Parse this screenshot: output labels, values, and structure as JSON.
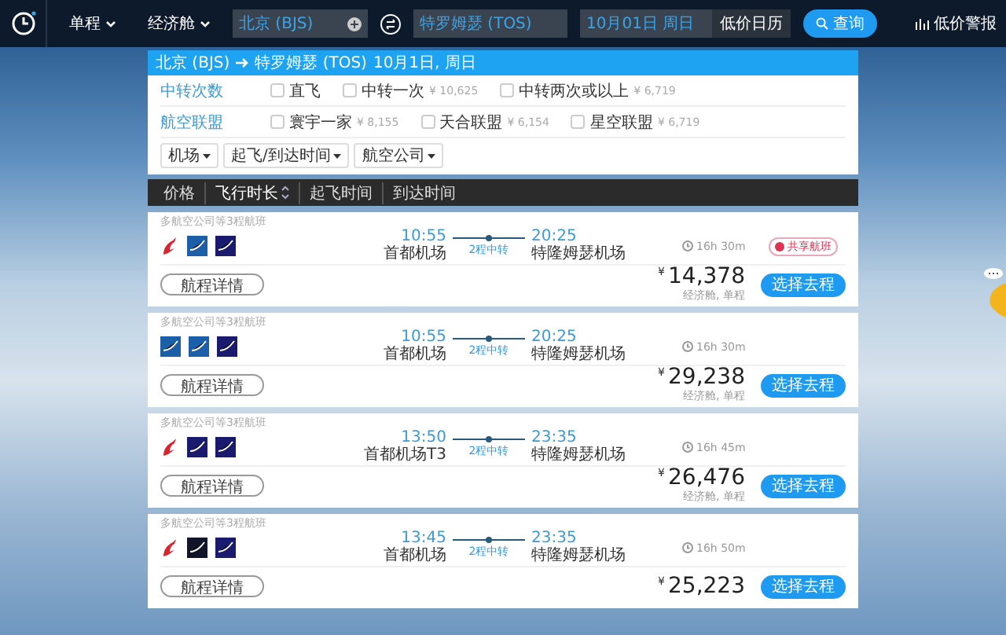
{
  "top_bar": {
    "trip_type": "单程",
    "cabin": "经济舱",
    "origin": "北京 (BJS)",
    "destination": "特罗姆瑟 (TOS)",
    "date": "10月01日 周日",
    "calendar_button": "低价日历",
    "search_button": "查询",
    "alert_link": "低价警报"
  },
  "summary": {
    "origin": "北京 (BJS)",
    "destination": "特罗姆瑟 (TOS)",
    "date": "10月1日, 周日"
  },
  "filters": [
    {
      "label": "中转次数",
      "options": [
        {
          "label": "直飞",
          "checked": false
        },
        {
          "label": "中转一次",
          "price": "¥ 10,625",
          "checked": false
        },
        {
          "label": "中转两次或以上",
          "price": "¥ 6,719",
          "checked": false
        }
      ]
    },
    {
      "label": "航空联盟",
      "options": [
        {
          "label": "寰宇一家",
          "price": "¥ 8,155",
          "checked": false
        },
        {
          "label": "天合联盟",
          "price": "¥ 6,154",
          "checked": false
        },
        {
          "label": "星空联盟",
          "price": "¥ 6,719",
          "checked": false
        }
      ]
    }
  ],
  "dropdowns": [
    "机场",
    "起飞/到达时间",
    "航空公司"
  ],
  "sort_bar": [
    {
      "label": "价格",
      "selected": false
    },
    {
      "label": "飞行时长",
      "selected": true
    },
    {
      "label": "起飞时间",
      "selected": false
    },
    {
      "label": "到达时间",
      "selected": false
    }
  ],
  "flights": [
    {
      "airlines_note": "多航空公司等3程航班",
      "logos": [
        {
          "kind": "bird"
        },
        {
          "kind": "blue"
        },
        {
          "kind": "navy"
        }
      ],
      "depart_time": "10:55",
      "depart_airport": "首都机场",
      "stops": "2程中转",
      "arrive_time": "20:25",
      "arrive_airport": "特隆姆瑟机场",
      "duration": "16h 30m",
      "badge": "共享航班",
      "details_button": "航程详情",
      "currency": "¥",
      "price": "14,378",
      "fare_note": "经济舱, 单程",
      "select_button": "选择去程"
    },
    {
      "airlines_note": "多航空公司等3程航班",
      "logos": [
        {
          "kind": "blue"
        },
        {
          "kind": "blue"
        },
        {
          "kind": "navy"
        }
      ],
      "depart_time": "10:55",
      "depart_airport": "首都机场",
      "stops": "2程中转",
      "arrive_time": "20:25",
      "arrive_airport": "特隆姆瑟机场",
      "duration": "16h 30m",
      "details_button": "航程详情",
      "currency": "¥",
      "price": "29,238",
      "fare_note": "经济舱, 单程",
      "select_button": "选择去程"
    },
    {
      "airlines_note": "多航空公司等3程航班",
      "logos": [
        {
          "kind": "bird"
        },
        {
          "kind": "navy"
        },
        {
          "kind": "navy"
        }
      ],
      "depart_time": "13:50",
      "depart_airport": "首都机场T3",
      "stops": "2程中转",
      "arrive_time": "23:35",
      "arrive_airport": "特隆姆瑟机场",
      "duration": "16h 45m",
      "details_button": "航程详情",
      "currency": "¥",
      "price": "26,476",
      "fare_note": "经济舱, 单程",
      "select_button": "选择去程"
    },
    {
      "airlines_note": "多航空公司等3程航班",
      "logos": [
        {
          "kind": "bird"
        },
        {
          "kind": "dark"
        },
        {
          "kind": "navy"
        }
      ],
      "depart_time": "13:45",
      "depart_airport": "首都机场",
      "stops": "2程中转",
      "arrive_time": "23:35",
      "arrive_airport": "特隆姆瑟机场",
      "duration": "16h 50m",
      "details_button": "航程详情",
      "currency": "¥",
      "price": "25,223",
      "select_button": "选择去程"
    }
  ]
}
